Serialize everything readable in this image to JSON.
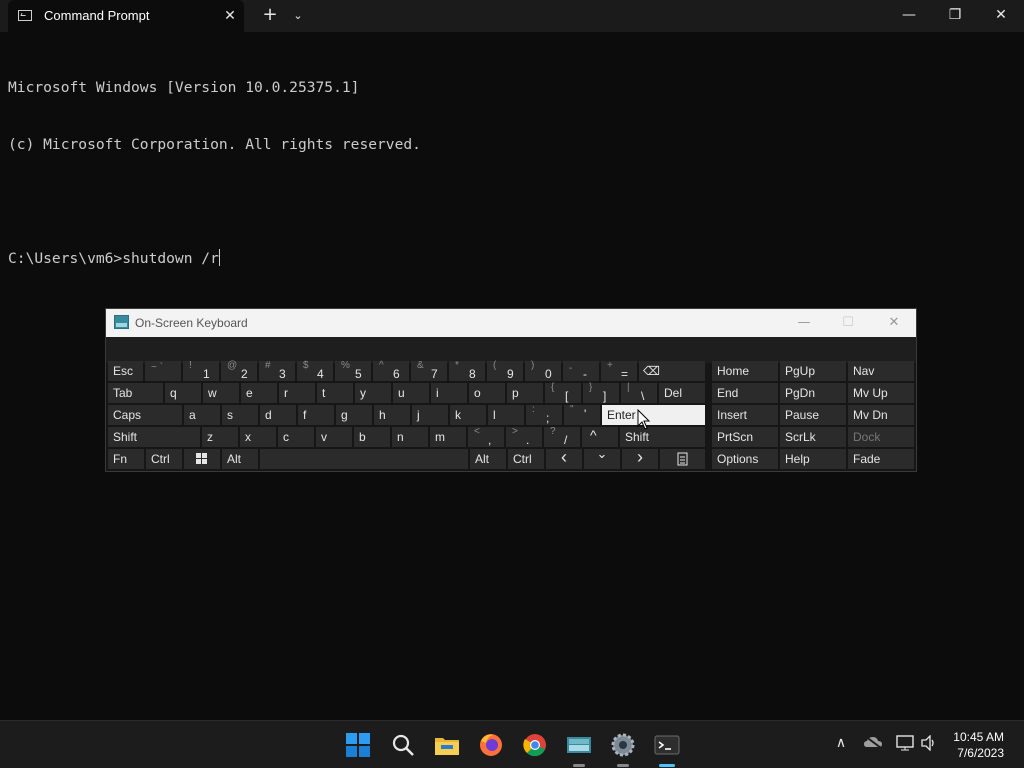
{
  "window": {
    "tab_title": "Command Prompt",
    "tab_close": "✕",
    "new_tab": "+",
    "tab_dropdown": "⌄",
    "minimize": "—",
    "maximize": "❐",
    "close": "✕"
  },
  "console": {
    "line1": "Microsoft Windows [Version 10.0.25375.1]",
    "line2": "(c) Microsoft Corporation. All rights reserved.",
    "prompt": "C:\\Users\\vm6>shutdown /r"
  },
  "osk": {
    "title": "On-Screen Keyboard",
    "row1": {
      "esc": "Esc",
      "k1": {
        "shift": "~ `",
        "main": ""
      },
      "k2": {
        "shift": "!",
        "main": "1"
      },
      "k3": {
        "shift": "@",
        "main": "2"
      },
      "k4": {
        "shift": "#",
        "main": "3"
      },
      "k5": {
        "shift": "$",
        "main": "4"
      },
      "k6": {
        "shift": "%",
        "main": "5"
      },
      "k7": {
        "shift": "^",
        "main": "6"
      },
      "k8": {
        "shift": "&",
        "main": "7"
      },
      "k9": {
        "shift": "*",
        "main": "8"
      },
      "k10": {
        "shift": "(",
        "main": "9"
      },
      "k11": {
        "shift": ")",
        "main": "0"
      },
      "k12": {
        "shift": "-",
        "main": "-"
      },
      "k13": {
        "shift": "+",
        "main": "="
      },
      "backspace": "⌫"
    },
    "row2": {
      "tab": "Tab",
      "letters": [
        "q",
        "w",
        "e",
        "r",
        "t",
        "y",
        "u",
        "i",
        "o",
        "p"
      ],
      "lb": {
        "shift": "{",
        "main": "["
      },
      "rb": {
        "shift": "}",
        "main": "]"
      },
      "bs": {
        "shift": "|",
        "main": "\\"
      },
      "del": "Del"
    },
    "row3": {
      "caps": "Caps",
      "letters": [
        "a",
        "s",
        "d",
        "f",
        "g",
        "h",
        "j",
        "k",
        "l"
      ],
      "semi": {
        "shift": ":",
        "main": ";"
      },
      "quote": {
        "shift": "\"",
        "main": "'"
      },
      "enter": "Enter"
    },
    "row4": {
      "shift_l": "Shift",
      "letters": [
        "z",
        "x",
        "c",
        "v",
        "b",
        "n",
        "m"
      ],
      "comma": {
        "shift": "<",
        "main": ","
      },
      "period": {
        "shift": ">",
        "main": "."
      },
      "slash": {
        "shift": "?",
        "main": "/"
      },
      "up": "^",
      "shift_r": "Shift"
    },
    "row5": {
      "fn": "Fn",
      "ctrl_l": "Ctrl",
      "alt_l": "Alt",
      "alt_r": "Alt",
      "ctrl_r": "Ctrl",
      "left": "‹",
      "down": "⌄",
      "right": "›"
    },
    "nav": {
      "home": "Home",
      "pgup": "PgUp",
      "nav": "Nav",
      "end": "End",
      "pgdn": "PgDn",
      "mvup": "Mv Up",
      "insert": "Insert",
      "pause": "Pause",
      "mvdn": "Mv Dn",
      "prtscn": "PrtScn",
      "scrlk": "ScrLk",
      "dock": "Dock",
      "options": "Options",
      "help": "Help",
      "fade": "Fade"
    }
  },
  "taskbar": {
    "time": "10:45 AM",
    "date": "7/6/2023"
  },
  "colors": {
    "accent": "#0078d4",
    "console_bg": "#0c0c0c",
    "console_fg": "#cccccc"
  }
}
